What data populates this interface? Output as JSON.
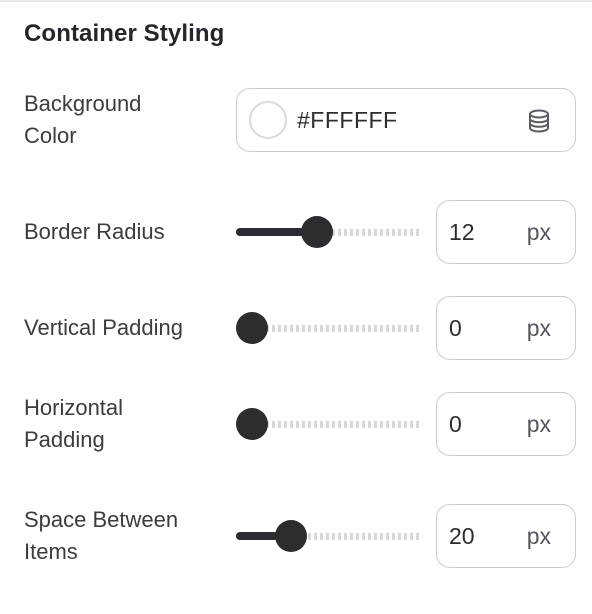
{
  "section": {
    "title": "Container Styling"
  },
  "background": {
    "label_line1": "Background",
    "label_line2": "Color",
    "color_value": "#FFFFFF",
    "swatch_color": "#FFFFFF",
    "icon": "database-icon"
  },
  "border_radius": {
    "label": "Border Radius",
    "value": "12",
    "unit": "px",
    "slider_fraction": 0.42
  },
  "vertical_padding": {
    "label": "Vertical Padding",
    "value": "0",
    "unit": "px",
    "slider_fraction": 0
  },
  "horizontal_padding": {
    "label_line1": "Horizontal",
    "label_line2": "Padding",
    "value": "0",
    "unit": "px",
    "slider_fraction": 0
  },
  "space_between": {
    "label_line1": "Space Between",
    "label_line2": "Items",
    "value": "20",
    "unit": "px",
    "slider_fraction": 0.25
  },
  "colors": {
    "slider_active": "#2B2D31",
    "slider_rail": "#D6D8DB",
    "border": "#C9CBCF"
  }
}
